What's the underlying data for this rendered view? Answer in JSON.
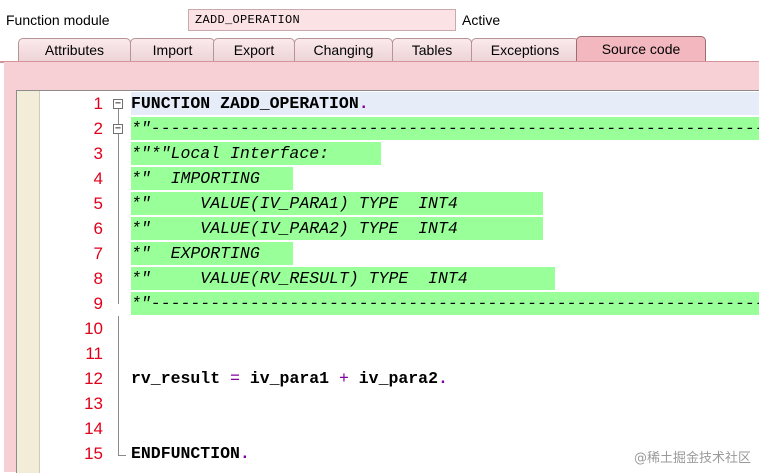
{
  "header": {
    "label": "Function module",
    "name": "ZADD_OPERATION",
    "status": "Active"
  },
  "tabs": [
    {
      "label": "Attributes"
    },
    {
      "label": "Import"
    },
    {
      "label": "Export"
    },
    {
      "label": "Changing"
    },
    {
      "label": "Tables"
    },
    {
      "label": "Exceptions"
    },
    {
      "label": "Source code",
      "active": true
    }
  ],
  "editor": {
    "lines": [
      {
        "no": "1",
        "text": "FUNCTION ZADD_OPERATION"
      },
      {
        "no": "2",
        "text": "*\"----------------------------------------------------------------"
      },
      {
        "no": "3",
        "text": "*\"*\"Local Interface:"
      },
      {
        "no": "4",
        "text": "*\"  IMPORTING"
      },
      {
        "no": "5",
        "text": "*\"     VALUE(IV_PARA1) TYPE  INT4"
      },
      {
        "no": "6",
        "text": "*\"     VALUE(IV_PARA2) TYPE  INT4"
      },
      {
        "no": "7",
        "text": "*\"  EXPORTING"
      },
      {
        "no": "8",
        "text": "*\"     VALUE(RV_RESULT) TYPE  INT4"
      },
      {
        "no": "9",
        "text": "*\"----------------------------------------------------------------"
      },
      {
        "no": "10",
        "text": ""
      },
      {
        "no": "11",
        "text": ""
      },
      {
        "no": "12",
        "text": "rv_result = iv_para1 + iv_para2"
      },
      {
        "no": "13",
        "text": ""
      },
      {
        "no": "14",
        "text": ""
      },
      {
        "no": "15",
        "text": "ENDFUNCTION"
      }
    ],
    "period": ".",
    "op_eq": "=",
    "op_plus": "+",
    "fold_minus": "−"
  },
  "watermark": "@稀土掘金技术社区",
  "colors": {
    "tab_active": "#f3b8bf",
    "comment_highlight": "#99ff99",
    "line_number": "#e0001a",
    "frame": "#f6d0d5"
  }
}
